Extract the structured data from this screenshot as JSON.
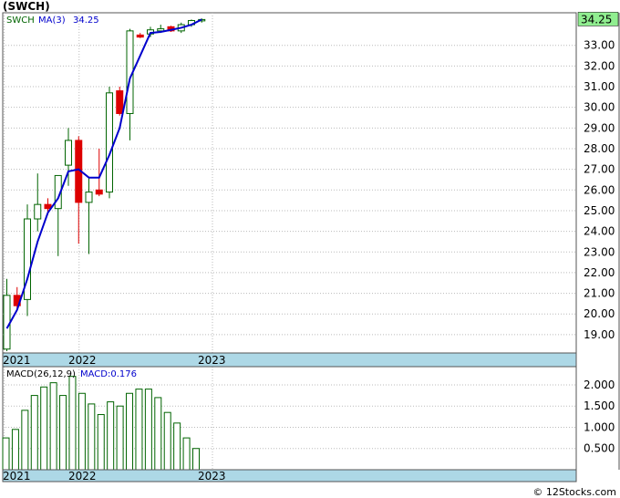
{
  "title": "(SWCH)",
  "credit": "© 12Stocks.com",
  "colors": {
    "up": "#006400",
    "down": "#dd0000",
    "ma": "#0000cc",
    "macd_bar": "#006400",
    "axis_strip": "#add8e6",
    "grid": "#bbbbbb",
    "price_tag_bg": "#90ee90"
  },
  "chart_data": [
    {
      "type": "candlestick",
      "symbol": "SWCH",
      "ma_label": "MA(3)",
      "ma_value": "34.25",
      "last_price_label": "34.25",
      "x_tick_labels": [
        "2021",
        "2022",
        "2023"
      ],
      "ylim": [
        18.2,
        34.25
      ],
      "y_ticks": [
        19,
        20,
        21,
        22,
        23,
        24,
        25,
        26,
        27,
        28,
        29,
        30,
        31,
        32,
        33
      ],
      "y_tick_labels": [
        "19.00",
        "20.00",
        "21.00",
        "22.00",
        "23.00",
        "24.00",
        "25.00",
        "26.00",
        "27.00",
        "28.00",
        "29.00",
        "30.00",
        "31.00",
        "32.00",
        "33.00"
      ],
      "candles": [
        {
          "o": 18.3,
          "h": 21.7,
          "l": 18.2,
          "c": 20.9
        },
        {
          "o": 20.9,
          "h": 21.3,
          "l": 20.2,
          "c": 20.4
        },
        {
          "o": 20.7,
          "h": 25.3,
          "l": 19.9,
          "c": 24.6
        },
        {
          "o": 24.6,
          "h": 26.8,
          "l": 24.0,
          "c": 25.3
        },
        {
          "o": 25.3,
          "h": 25.6,
          "l": 24.8,
          "c": 25.1
        },
        {
          "o": 25.1,
          "h": 26.7,
          "l": 22.8,
          "c": 26.7
        },
        {
          "o": 27.2,
          "h": 29.0,
          "l": 26.2,
          "c": 28.4
        },
        {
          "o": 28.4,
          "h": 28.6,
          "l": 23.4,
          "c": 25.4
        },
        {
          "o": 25.4,
          "h": 26.6,
          "l": 22.9,
          "c": 25.9
        },
        {
          "o": 26.0,
          "h": 28.0,
          "l": 25.7,
          "c": 25.8
        },
        {
          "o": 25.9,
          "h": 31.0,
          "l": 25.6,
          "c": 30.7
        },
        {
          "o": 30.8,
          "h": 31.0,
          "l": 29.6,
          "c": 29.7
        },
        {
          "o": 29.7,
          "h": 33.8,
          "l": 28.4,
          "c": 33.7
        },
        {
          "o": 33.5,
          "h": 33.6,
          "l": 33.35,
          "c": 33.4
        },
        {
          "o": 33.55,
          "h": 33.9,
          "l": 33.4,
          "c": 33.75
        },
        {
          "o": 33.7,
          "h": 34.0,
          "l": 33.6,
          "c": 33.8
        },
        {
          "o": 33.9,
          "h": 33.95,
          "l": 33.65,
          "c": 33.7
        },
        {
          "o": 33.7,
          "h": 34.1,
          "l": 33.6,
          "c": 34.0
        },
        {
          "o": 34.0,
          "h": 34.25,
          "l": 33.9,
          "c": 34.2
        },
        {
          "o": 34.2,
          "h": 34.3,
          "l": 34.1,
          "c": 34.25
        }
      ],
      "ma": [
        19.3,
        20.2,
        21.7,
        23.5,
        24.9,
        25.6,
        26.9,
        27.0,
        26.6,
        26.6,
        27.7,
        29.0,
        31.4,
        32.5,
        33.6,
        33.65,
        33.75,
        33.85,
        34.0,
        34.25
      ]
    },
    {
      "type": "bar",
      "label": "MACD(26,12,9)",
      "value_label": "MACD:0.176",
      "ylim": [
        0,
        2.3
      ],
      "y_ticks": [
        0.5,
        1.0,
        1.5,
        2.0
      ],
      "y_tick_labels": [
        "0.500",
        "1.000",
        "1.500",
        "2.000"
      ],
      "x_tick_labels": [
        "2021",
        "2022",
        "2023"
      ],
      "values": [
        0.75,
        0.95,
        1.4,
        1.75,
        1.95,
        2.05,
        1.75,
        2.2,
        1.8,
        1.55,
        1.3,
        1.6,
        1.5,
        1.8,
        1.9,
        1.9,
        1.7,
        1.35,
        1.1,
        0.75,
        0.5
      ]
    }
  ]
}
